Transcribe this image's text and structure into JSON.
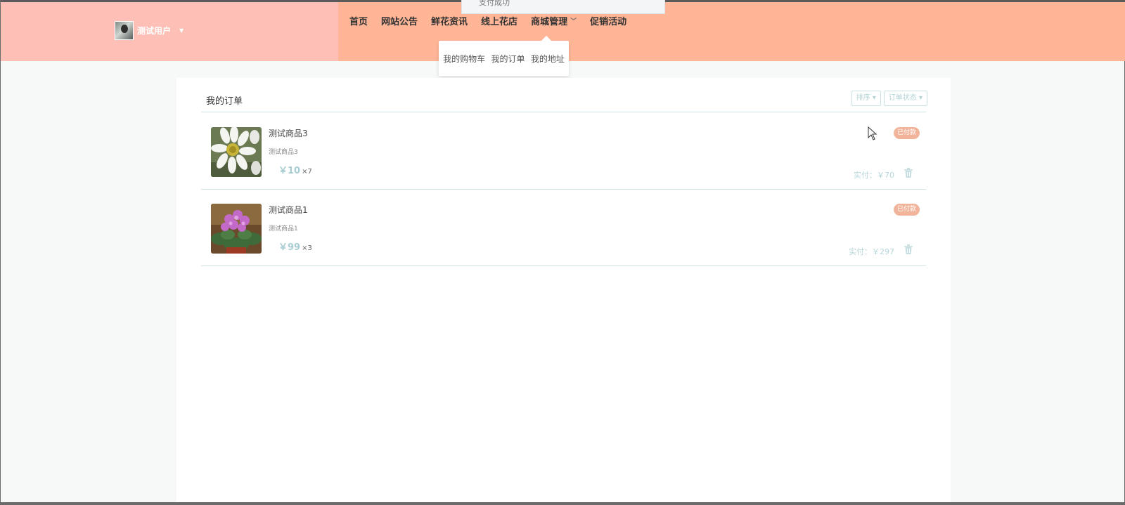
{
  "header": {
    "user_name": "测试用户",
    "toast_text": "支付成功",
    "nav": [
      {
        "label": "首页"
      },
      {
        "label": "网站公告"
      },
      {
        "label": "鲜花资讯"
      },
      {
        "label": "线上花店"
      },
      {
        "label": "商城管理"
      },
      {
        "label": "促销活动"
      }
    ],
    "dropdown": [
      "我的购物车",
      "我的订单",
      "我的地址"
    ]
  },
  "main": {
    "title": "我的订单",
    "sort_label": "排序",
    "status_filter_label": "订单状态",
    "orders": [
      {
        "name": "测试商品3",
        "desc": "测试商品3",
        "price": "￥10",
        "qty": "×7",
        "status": "已付款",
        "paid_label": "实付：",
        "paid_amount": "￥70",
        "image": "daisy"
      },
      {
        "name": "测试商品1",
        "desc": "测试商品1",
        "price": "￥99",
        "qty": "×3",
        "status": "已付款",
        "paid_label": "实付：",
        "paid_amount": "￥297",
        "image": "violet"
      }
    ]
  },
  "colors": {
    "header_left": "#fec0b6",
    "header_right": "#ffb596",
    "badge": "#f1b49a",
    "accent": "#a8cdd2"
  }
}
